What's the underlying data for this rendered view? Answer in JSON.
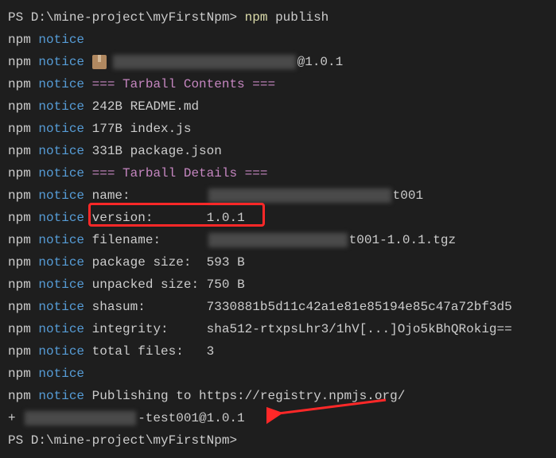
{
  "prompt": {
    "prefix": "PS D:\\mine-project\\myFirstNpm> ",
    "cmd_npm": "npm",
    "cmd_action": " publish"
  },
  "lines": {
    "npm": "npm",
    "notice": " notice ",
    "pkg_version_top": "@1.0.1",
    "tarball_contents": "=== Tarball Contents ===",
    "file1": "242B README.md",
    "file2": "177B index.js",
    "file3": "331B package.json",
    "tarball_details": "=== Tarball Details ===",
    "name_label": "name:          ",
    "name_suffix": "t001",
    "version_label": "version:       ",
    "version_value": "1.0.1",
    "filename_label": "filename:      ",
    "filename_suffix": "t001-1.0.1.tgz",
    "pkgsize_label": "package size:  ",
    "pkgsize_value": "593 B",
    "unpacked_label": "unpacked size: ",
    "unpacked_value": "750 B",
    "shasum_label": "shasum:        ",
    "shasum_value": "7330881b5d11c42a1e81e85194e85c47a72bf3d5",
    "integrity_label": "integrity:     ",
    "integrity_value": "sha512-rtxpsLhr3/1hV[...]Ojo5kBhQRokig==",
    "total_label": "total files:   ",
    "total_value": "3",
    "publishing_label": "Publishing to ",
    "publishing_url": "https://registry.npmjs.org/",
    "success_prefix": "+ ",
    "success_suffix": "-test001@1.0.1",
    "final_prompt": "PS D:\\mine-project\\myFirstNpm>"
  }
}
